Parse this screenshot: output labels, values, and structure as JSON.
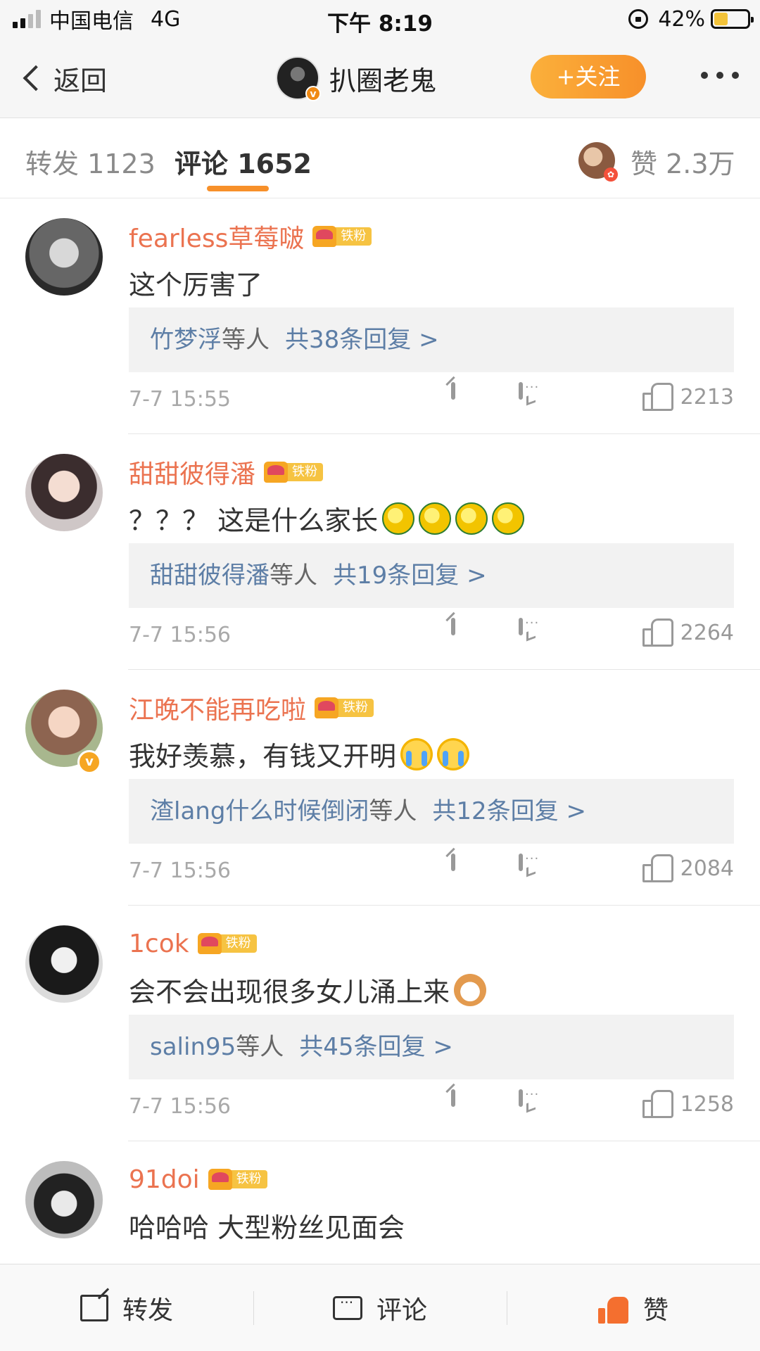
{
  "status_bar": {
    "carrier": "中国电信",
    "network": "4G",
    "time": "下午 8:19",
    "battery_pct": "42%",
    "battery_level": 0.42,
    "battery_color": "#f3c33a"
  },
  "nav": {
    "back_label": "返回",
    "title": "扒圈老鬼",
    "follow_label": "+关注",
    "verified_mark": "v"
  },
  "tabs": {
    "repost_label": "转发 1123",
    "comment_label": "评论 1652",
    "likes_label": "赞 2.3万",
    "active_color": "#f7902a"
  },
  "comments": [
    {
      "name": "fearless草莓啵",
      "fan_badge": "铁粉",
      "text": "这个厉害了",
      "emojis": [],
      "reply_names": "竹梦浮",
      "reply_suffix": "等人",
      "reply_count": "共38条回复 >",
      "time": "7-7 15:55",
      "likes": "2213",
      "verified": false
    },
    {
      "name": "甜甜彼得潘",
      "fan_badge": "铁粉",
      "text": "？？？ 这是什么家长",
      "emojis": [
        "lemon-emoji",
        "lemon-emoji",
        "lemon-emoji",
        "lemon-emoji"
      ],
      "reply_names": "甜甜彼得潘",
      "reply_suffix": "等人",
      "reply_count": "共19条回复 >",
      "time": "7-7 15:56",
      "likes": "2264",
      "verified": false
    },
    {
      "name": "江晚不能再吃啦",
      "fan_badge": "铁粉",
      "text": "我好羡慕，有钱又开明",
      "emojis": [
        "crying-emoji",
        "crying-emoji"
      ],
      "reply_names": "渣lang什么时候倒闭",
      "reply_suffix": "等人",
      "reply_count": "共12条回复 >",
      "time": "7-7 15:56",
      "likes": "2084",
      "verified": true,
      "verified_mark": "v"
    },
    {
      "name": "1cok",
      "fan_badge": "铁粉",
      "text": "会不会出现很多女儿涌上来",
      "emojis": [
        "cat-emoji"
      ],
      "reply_names": "salin95",
      "reply_suffix": "等人",
      "reply_count": "共45条回复 >",
      "time": "7-7 15:56",
      "likes": "1258",
      "verified": false
    },
    {
      "name": "91doi",
      "fan_badge": "铁粉",
      "text": "哈哈哈 大型粉丝见面会",
      "emojis": [],
      "reply_names": "",
      "reply_suffix": "",
      "reply_count": "",
      "time": "",
      "likes": "",
      "verified": false
    }
  ],
  "bottom_bar": {
    "repost_label": "转发",
    "comment_label": "评论",
    "like_label": "赞",
    "like_color": "#f46f2f"
  },
  "colors": {
    "username": "#eb7350",
    "reply_link": "#5d7ea6",
    "follow_button": "#f7902a"
  }
}
